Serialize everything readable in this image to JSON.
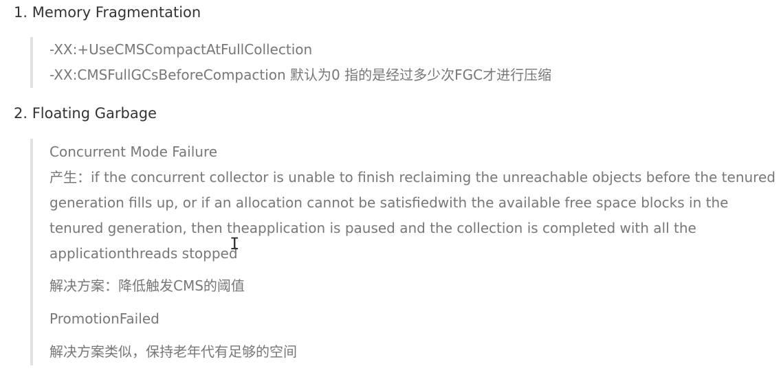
{
  "section1": {
    "heading": "1. Memory Fragmentation",
    "lines": [
      "-XX:+UseCMSCompactAtFullCollection",
      "-XX:CMSFullGCsBeforeCompaction 默认为0 指的是经过多少次FGC才进行压缩"
    ]
  },
  "section2": {
    "heading": "2. Floating Garbage",
    "failure_title": "Concurrent Mode Failure",
    "cause_text": "产生：if the concurrent collector is unable to finish reclaiming the unreachable objects before the tenured generation fills up, or if an allocation cannot be satisfiedwith the available free space blocks in the tenured generation, then theapplication is paused and the collection is completed with all the applicationthreads stopped",
    "solution1": "解决方案：降低触发CMS的阈值",
    "promotion_title": "PromotionFailed",
    "solution2": "解决方案类似，保持老年代有足够的空间"
  },
  "cursor": {
    "icon": "text-cursor-icon",
    "glyph": "I"
  }
}
